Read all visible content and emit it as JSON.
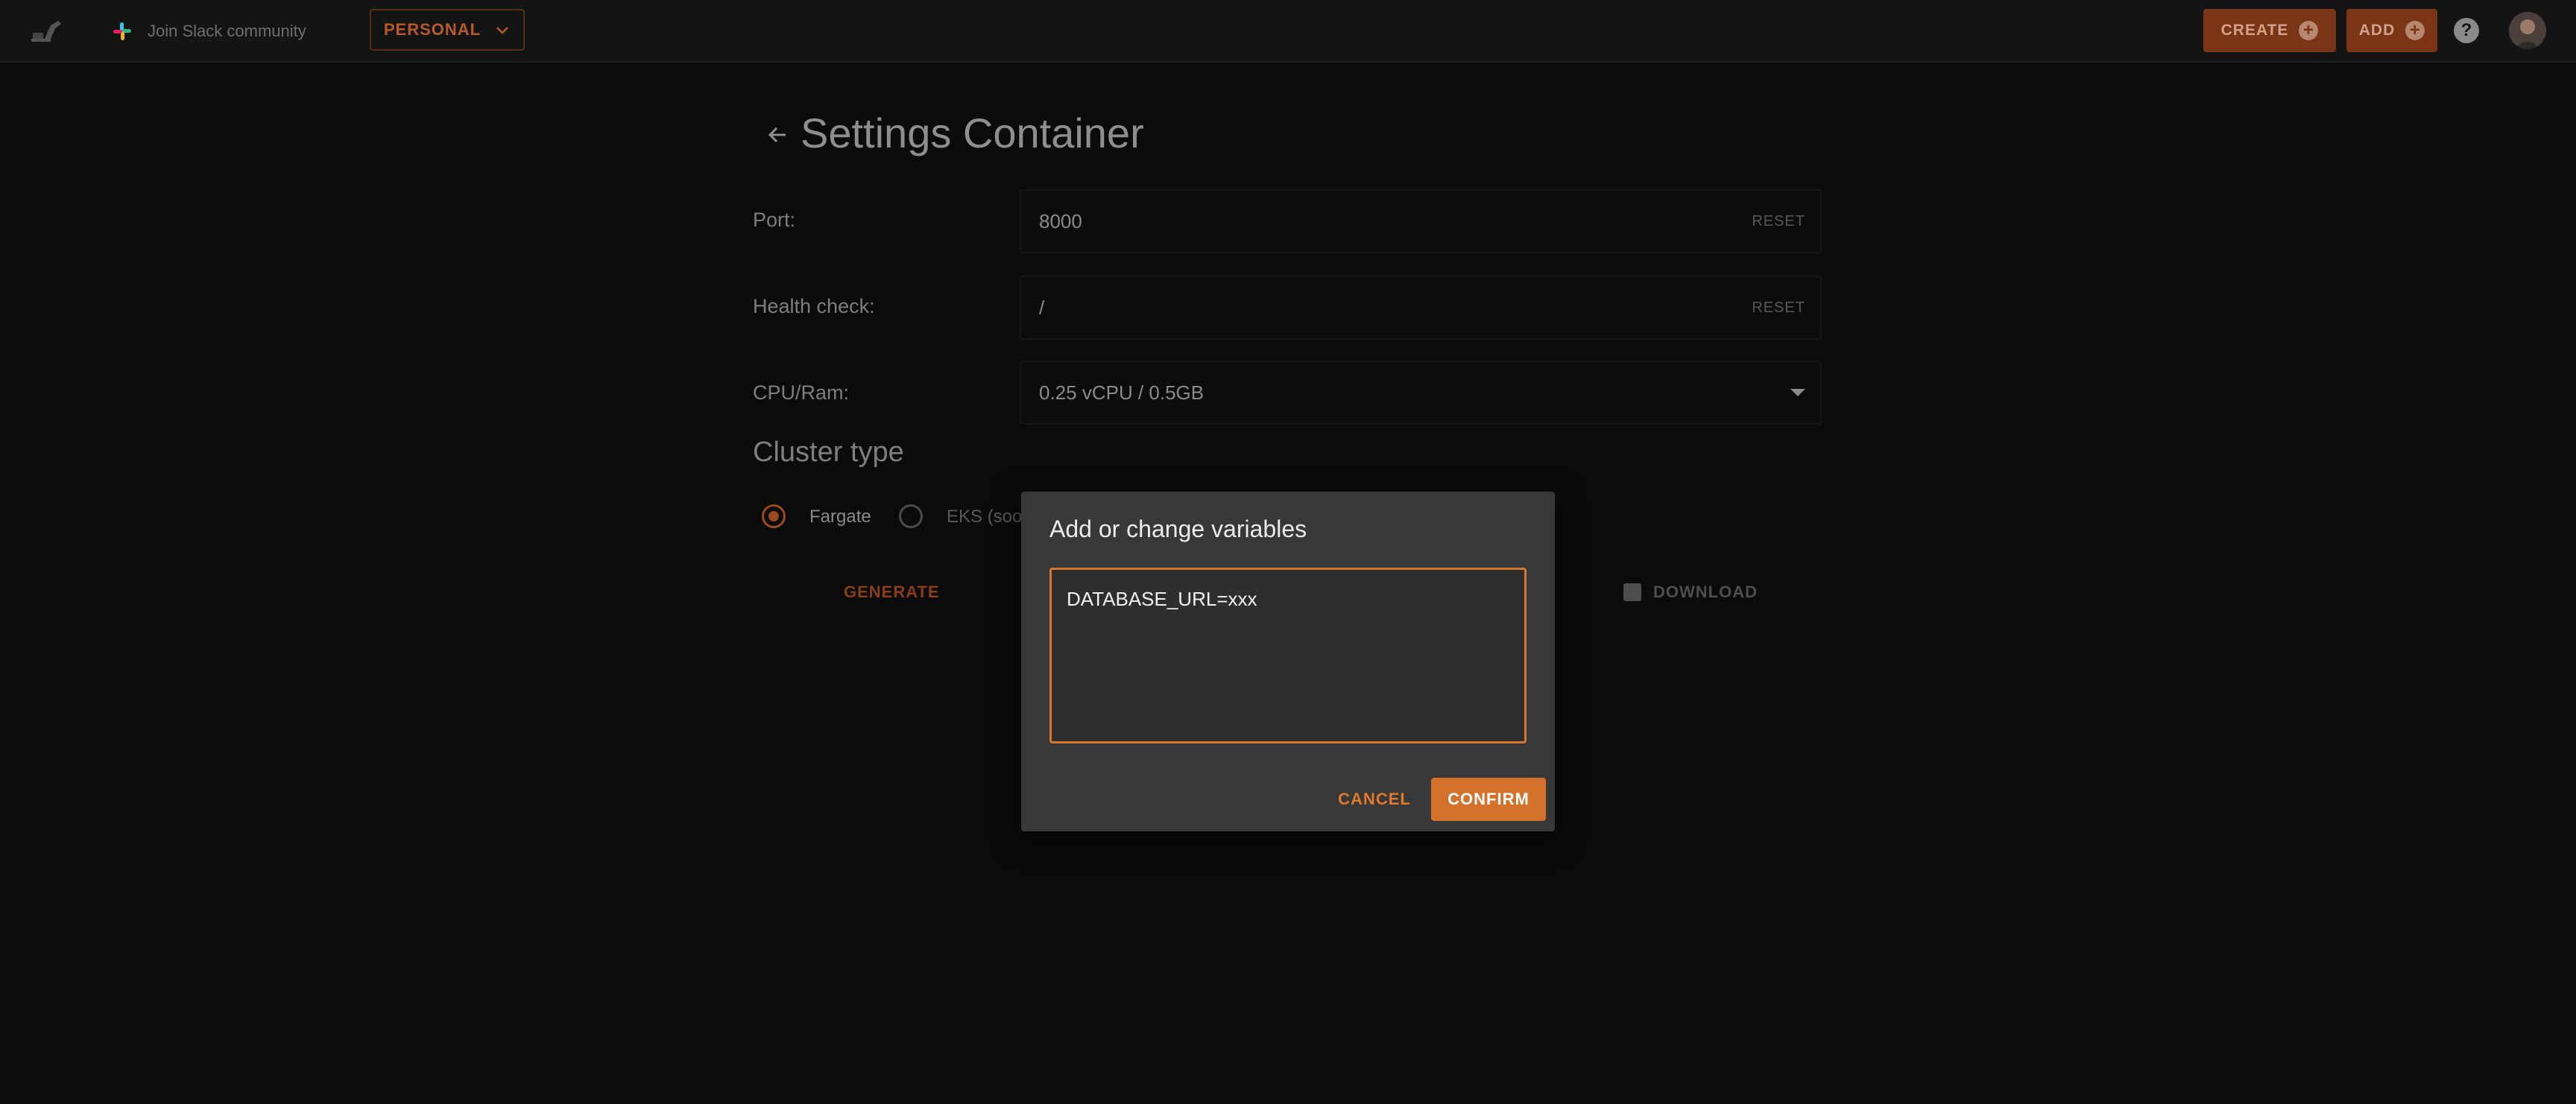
{
  "topbar": {
    "slack_label": "Join Slack community",
    "workspace_label": "PERSONAL",
    "create_label": "CREATE",
    "add_label": "ADD",
    "help_label": "?"
  },
  "page": {
    "title": "Settings Container",
    "port": {
      "label": "Port:",
      "value": "8000",
      "reset": "RESET"
    },
    "health": {
      "label": "Health check:",
      "value": "/",
      "reset": "RESET"
    },
    "cpu": {
      "label": "CPU/Ram:",
      "value": "0.25 vCPU / 0.5GB"
    },
    "cluster_title": "Cluster type",
    "cluster_options": [
      "Fargate",
      "EKS (soo"
    ],
    "generate_label": "GENERATE",
    "download_label": "DOWNLOAD"
  },
  "modal": {
    "title": "Add or change variables",
    "text": "DATABASE_URL=xxx",
    "cancel_label": "CANCEL",
    "confirm_label": "CONFIRM"
  },
  "colors": {
    "accent": "#d3722b",
    "dim_accent": "#7a3416",
    "background": "#0b0b0b"
  }
}
